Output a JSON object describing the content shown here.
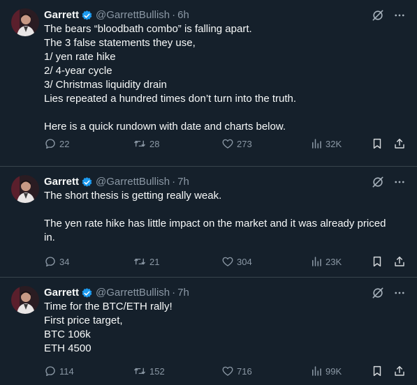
{
  "tweets": [
    {
      "author_name": "Garrett",
      "handle": "@GarrettBullish",
      "time": "6h",
      "text": "The bears “bloodbath combo” is falling apart.\nThe 3 false statements they use,\n1/ yen rate hike\n2/ 4-year cycle\n3/ Christmas liquidity drain\nLies repeated a hundred times don’t turn into the truth.\n\nHere is a quick rundown with date and charts below.",
      "replies": "22",
      "retweets": "28",
      "likes": "273",
      "views": "32K"
    },
    {
      "author_name": "Garrett",
      "handle": "@GarrettBullish",
      "time": "7h",
      "text": "The short thesis is getting really weak.\n\nThe yen rate hike has little impact on the market and it was already priced in.",
      "replies": "34",
      "retweets": "21",
      "likes": "304",
      "views": "23K"
    },
    {
      "author_name": "Garrett",
      "handle": "@GarrettBullish",
      "time": "7h",
      "text": "Time for the BTC/ETH rally!\nFirst price target,\nBTC 106k\nETH 4500",
      "replies": "114",
      "retweets": "152",
      "likes": "716",
      "views": "99K"
    }
  ],
  "icons": {
    "reply": "reply-icon",
    "retweet": "retweet-icon",
    "like": "heart-icon",
    "views": "views-icon",
    "bookmark": "bookmark-icon",
    "share": "share-icon",
    "grok": "grok-icon",
    "more": "more-icon",
    "verified": "verified-badge-icon"
  },
  "colors": {
    "background": "#15202b",
    "text": "#f7f9f9",
    "secondary": "#8b98a5",
    "verified": "#1d9bf0",
    "divider": "#38444d"
  }
}
